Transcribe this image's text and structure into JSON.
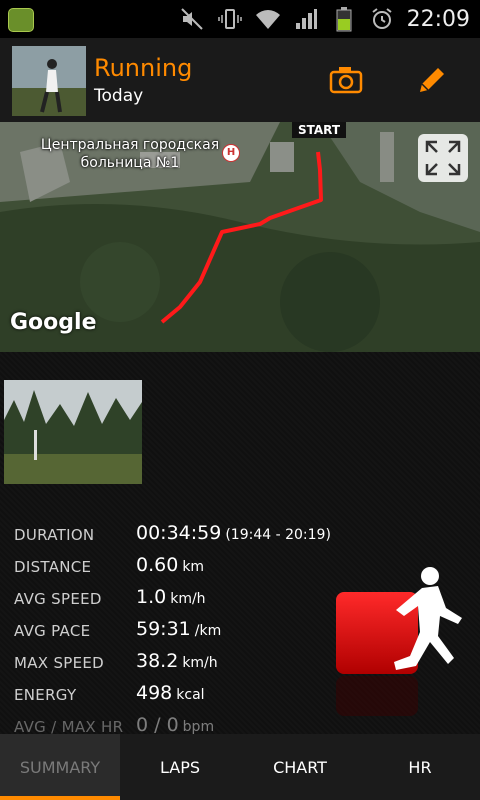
{
  "status_bar": {
    "time": "22:09",
    "icons": [
      "app-icon",
      "mute-icon",
      "vibrate-icon",
      "wifi-icon",
      "signal-icon",
      "battery-icon",
      "alarm-icon"
    ]
  },
  "header": {
    "title": "Running",
    "subtitle": "Today",
    "camera_icon": "camera-icon",
    "edit_icon": "edit-icon"
  },
  "map": {
    "place_label": "Центральная городская больница №1",
    "hospital_marker": "H",
    "start_label": "START",
    "provider": "Google",
    "expand_icon": "expand-icon"
  },
  "stats": [
    {
      "label": "DURATION",
      "value": "00:34:59",
      "unit": "(19:44 - 20:19)"
    },
    {
      "label": "DISTANCE",
      "value": "0.60",
      "unit": "km"
    },
    {
      "label": "AVG SPEED",
      "value": "1.0",
      "unit": "km/h"
    },
    {
      "label": "AVG PACE",
      "value": "59:31",
      "unit": "/km"
    },
    {
      "label": "MAX SPEED",
      "value": "38.2",
      "unit": "km/h"
    },
    {
      "label": "ENERGY",
      "value": "498",
      "unit": "kcal"
    },
    {
      "label": "AVG / MAX HR",
      "value": "0 / 0",
      "unit": "bpm"
    }
  ],
  "tabs": [
    {
      "label": "SUMMARY",
      "active": true
    },
    {
      "label": "LAPS",
      "active": false
    },
    {
      "label": "CHART",
      "active": false
    },
    {
      "label": "HR",
      "active": false
    }
  ],
  "colors": {
    "accent": "#ff8a00",
    "route": "#ff1a1a",
    "sport_badge": "#e00000"
  }
}
